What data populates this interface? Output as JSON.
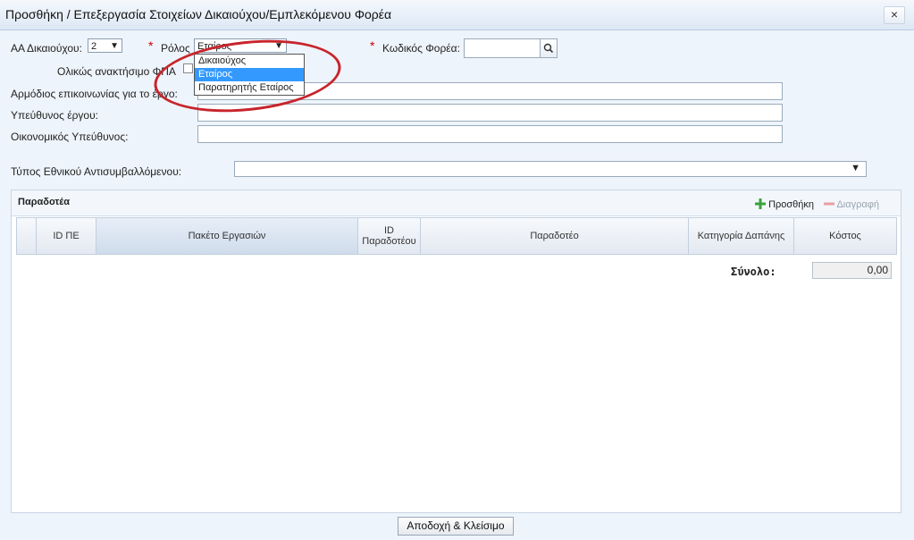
{
  "dialog": {
    "title": "Προσθήκη / Επεξεργασία Στοιχείων Δικαιούχου/Εμπλεκόμενου Φορέα",
    "close_glyph": "×"
  },
  "form": {
    "aa_label": "ΑΑ Δικαιούχου:",
    "aa_value": "2",
    "role_label": "Ρόλος",
    "role_value": "Εταίρος",
    "role_options": [
      "Δικαιούχος",
      "Εταίρος",
      "Παρατηρητής Εταίρος"
    ],
    "role_selected_index": 1,
    "code_label": "Κωδικός Φορέα:",
    "code_value": "",
    "vat_label": "Ολικώς ανακτήσιμο ΦΠΑ",
    "contact_label": "Αρμόδιος επικοινωνίας για το έργο:",
    "project_manager_label": "Υπεύθυνος έργου:",
    "financial_manager_label": "Οικονομικός Υπεύθυνος:",
    "contractor_type_label": "Τύπος Εθνικού Αντισυμβαλλόμενου:",
    "contractor_type_value": "",
    "required_marker": "*",
    "dropdown_arrow": "▼"
  },
  "deliverables": {
    "title": "Παραδοτέα",
    "add_label": "Προσθήκη",
    "delete_label": "Διαγραφή",
    "columns": [
      "ID ΠΕ",
      "Πακέτο Εργασιών",
      "ID Παραδοτέου",
      "Παραδοτέο",
      "Κατηγορία Δαπάνης",
      "Κόστος"
    ],
    "total_label": "Σύνολο:",
    "total_value": "0,00"
  },
  "footer": {
    "accept_close_label": "Αποδοχή & Κλείσιμο"
  },
  "colors": {
    "annotation": "#c8242c",
    "selection": "#3399ff",
    "required": "#cc0000"
  }
}
